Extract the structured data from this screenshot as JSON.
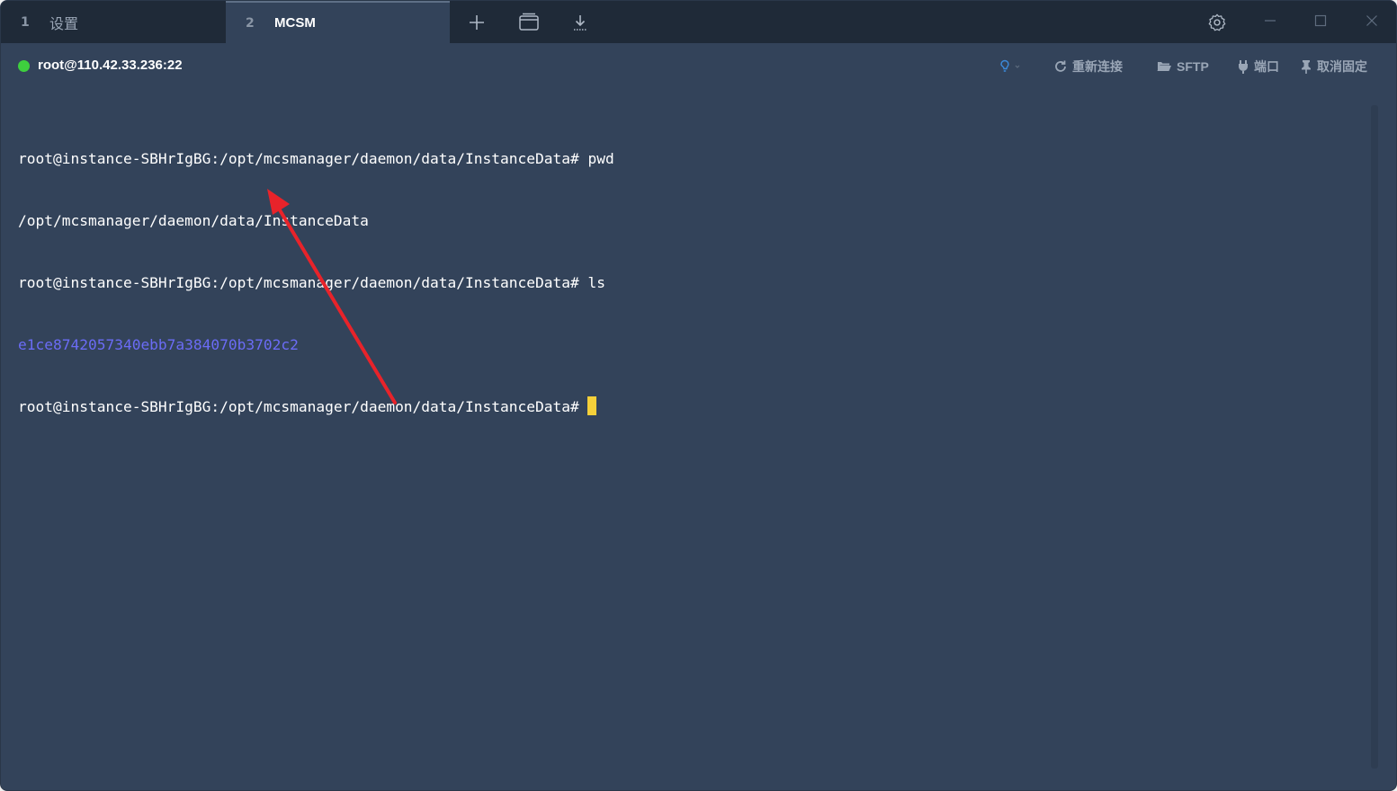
{
  "tabs": [
    {
      "index": "1",
      "label": "设置"
    },
    {
      "index": "2",
      "label": "MCSM"
    }
  ],
  "titlebar": {
    "icons": [
      "plus-icon",
      "window-icon",
      "download-icon",
      "gear-icon",
      "minimize-icon",
      "maximize-icon",
      "close-icon"
    ]
  },
  "connection": {
    "host": "root@110.42.33.236:22",
    "status_color": "#3ecf3e",
    "actions": {
      "reconnect": "重新连接",
      "sftp": "SFTP",
      "port": "端口",
      "unpin": "取消固定"
    }
  },
  "terminal": {
    "lines": [
      "root@instance-SBHrIgBG:/opt/mcsmanager/daemon/data/InstanceData# pwd",
      "/opt/mcsmanager/daemon/data/InstanceData",
      "root@instance-SBHrIgBG:/opt/mcsmanager/daemon/data/InstanceData# ls",
      "e1ce8742057340ebb7a384070b3702c2",
      "root@instance-SBHrIgBG:/opt/mcsmanager/daemon/data/InstanceData# "
    ],
    "dir_color": "#6b6cf6",
    "cursor_color": "#f5d03a"
  },
  "colors": {
    "background": "#33435a",
    "titlebar": "#1f2a38",
    "annotation_arrow": "#e8232a"
  }
}
